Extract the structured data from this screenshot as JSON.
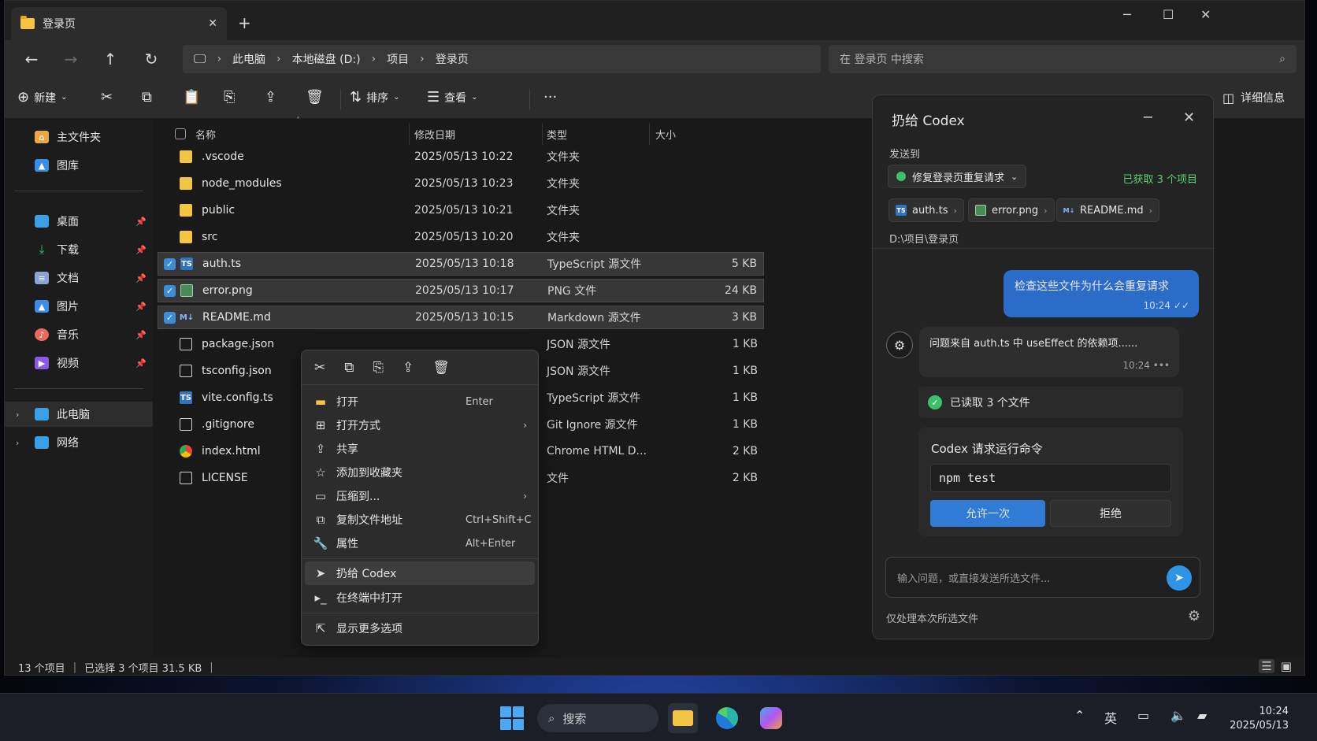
{
  "window": {
    "tab_title": "登录页",
    "new_tab": "+",
    "minimize": "─",
    "maximize": "☐",
    "close": "✕"
  },
  "address": {
    "crumbs": [
      "此电脑",
      "本地磁盘 (D:)",
      "项目",
      "登录页"
    ],
    "search_placeholder": "在 登录页 中搜索"
  },
  "toolbar": {
    "new_label": "新建",
    "sort_label": "排序",
    "view_label": "查看",
    "more": "···",
    "details_label": "详细信息"
  },
  "sidebar": {
    "items": [
      {
        "label": "主文件夹",
        "icon": "home-icon",
        "color": "#e8a84a"
      },
      {
        "label": "图库",
        "icon": "gallery-icon",
        "color": "#3a8ee6"
      },
      {
        "label": "桌面",
        "icon": "desktop-icon",
        "color": "#3aa0e6"
      },
      {
        "label": "下载",
        "icon": "download-icon",
        "color": "#3cc06e"
      },
      {
        "label": "文档",
        "icon": "documents-icon",
        "color": "#8aa4d6"
      },
      {
        "label": "图片",
        "icon": "pictures-icon",
        "color": "#3a8ee6"
      },
      {
        "label": "音乐",
        "icon": "music-icon",
        "color": "#e86a5a"
      },
      {
        "label": "视频",
        "icon": "videos-icon",
        "color": "#8a5ae6"
      },
      {
        "label": "此电脑",
        "icon": "this-pc-icon",
        "color": "#3aa0e6"
      },
      {
        "label": "网络",
        "icon": "network-icon",
        "color": "#3aa0e6"
      }
    ]
  },
  "columns": {
    "name": "名称",
    "date": "修改日期",
    "type": "类型",
    "size": "大小"
  },
  "files": [
    {
      "name": ".vscode",
      "date": "2025/05/13 10:22",
      "type": "文件夹",
      "size": "",
      "icon": "folder-icon",
      "selected": false
    },
    {
      "name": "node_modules",
      "date": "2025/05/13 10:23",
      "type": "文件夹",
      "size": "",
      "icon": "folder-icon",
      "selected": false
    },
    {
      "name": "public",
      "date": "2025/05/13 10:21",
      "type": "文件夹",
      "size": "",
      "icon": "folder-icon",
      "selected": false
    },
    {
      "name": "src",
      "date": "2025/05/13 10:20",
      "type": "文件夹",
      "size": "",
      "icon": "folder-icon",
      "selected": false
    },
    {
      "name": "auth.ts",
      "date": "2025/05/13 10:18",
      "type": "TypeScript 源文件",
      "size": "5 KB",
      "icon": "typescript-icon",
      "selected": true
    },
    {
      "name": "error.png",
      "date": "2025/05/13 10:17",
      "type": "PNG 文件",
      "size": "24 KB",
      "icon": "image-icon",
      "selected": true
    },
    {
      "name": "README.md",
      "date": "2025/05/13 10:15",
      "type": "Markdown 源文件",
      "size": "3 KB",
      "icon": "markdown-icon",
      "selected": true
    },
    {
      "name": "package.json",
      "date": "",
      "type": "JSON 源文件",
      "size": "1 KB",
      "icon": "json-icon",
      "selected": false
    },
    {
      "name": "tsconfig.json",
      "date": "",
      "type": "JSON 源文件",
      "size": "1 KB",
      "icon": "json-icon",
      "selected": false
    },
    {
      "name": "vite.config.ts",
      "date": "",
      "type": "TypeScript 源文件",
      "size": "1 KB",
      "icon": "typescript-icon",
      "selected": false
    },
    {
      "name": ".gitignore",
      "date": "",
      "type": "Git Ignore 源文件",
      "size": "1 KB",
      "icon": "file-icon",
      "selected": false
    },
    {
      "name": "index.html",
      "date": "",
      "type": "Chrome HTML D...",
      "size": "2 KB",
      "icon": "chrome-icon",
      "selected": false
    },
    {
      "name": "LICENSE",
      "date": "",
      "type": "文件",
      "size": "2 KB",
      "icon": "file-icon",
      "selected": false
    }
  ],
  "context_menu": {
    "items": [
      {
        "label": "打开",
        "key": "Enter",
        "icon": "folder-open-icon",
        "submenu": false
      },
      {
        "label": "打开方式",
        "key": "",
        "icon": "open-with-icon",
        "submenu": true
      },
      {
        "label": "共享",
        "key": "",
        "icon": "share-icon",
        "submenu": false
      },
      {
        "label": "添加到收藏夹",
        "key": "",
        "icon": "star-icon",
        "submenu": false
      },
      {
        "label": "压缩到...",
        "key": "",
        "icon": "archive-icon",
        "submenu": true
      },
      {
        "label": "复制文件地址",
        "key": "Ctrl+Shift+C",
        "icon": "copy-path-icon",
        "submenu": false
      },
      {
        "label": "属性",
        "key": "Alt+Enter",
        "icon": "wrench-icon",
        "submenu": false
      },
      {
        "label": "扔给 Codex",
        "key": "",
        "icon": "send-icon",
        "submenu": false
      },
      {
        "label": "在终端中打开",
        "key": "",
        "icon": "terminal-icon",
        "submenu": false
      },
      {
        "label": "显示更多选项",
        "key": "",
        "icon": "more-options-icon",
        "submenu": false
      }
    ]
  },
  "codex": {
    "title": "扔给 Codex",
    "send_to_label": "发送到",
    "target": "修复登录页重复请求",
    "fetched": "已获取 3 个项目",
    "attachments": [
      {
        "name": "auth.ts",
        "icon": "typescript-icon"
      },
      {
        "name": "error.png",
        "icon": "image-icon"
      },
      {
        "name": "README.md",
        "icon": "markdown-icon"
      }
    ],
    "path": "D:\\项目\\登录页",
    "user_message": "检查这些文件为什么会重复请求",
    "user_time": "10:24",
    "bot_message": "问题来自 auth.ts 中 useEffect 的依赖项......",
    "bot_time": "10:24",
    "read_status": "已读取 3 个文件",
    "cmd_title": "Codex 请求运行命令",
    "command": "npm test",
    "allow_label": "允许一次",
    "deny_label": "拒绝",
    "input_placeholder": "输入问题，或直接发送所选文件...",
    "footer": "仅处理本次所选文件"
  },
  "status": {
    "count": "13 个项目",
    "selection": "已选择 3 个项目 31.5 KB"
  },
  "taskbar": {
    "search_label": "搜索",
    "ime": "英",
    "time": "10:24",
    "date": "2025/05/13"
  }
}
